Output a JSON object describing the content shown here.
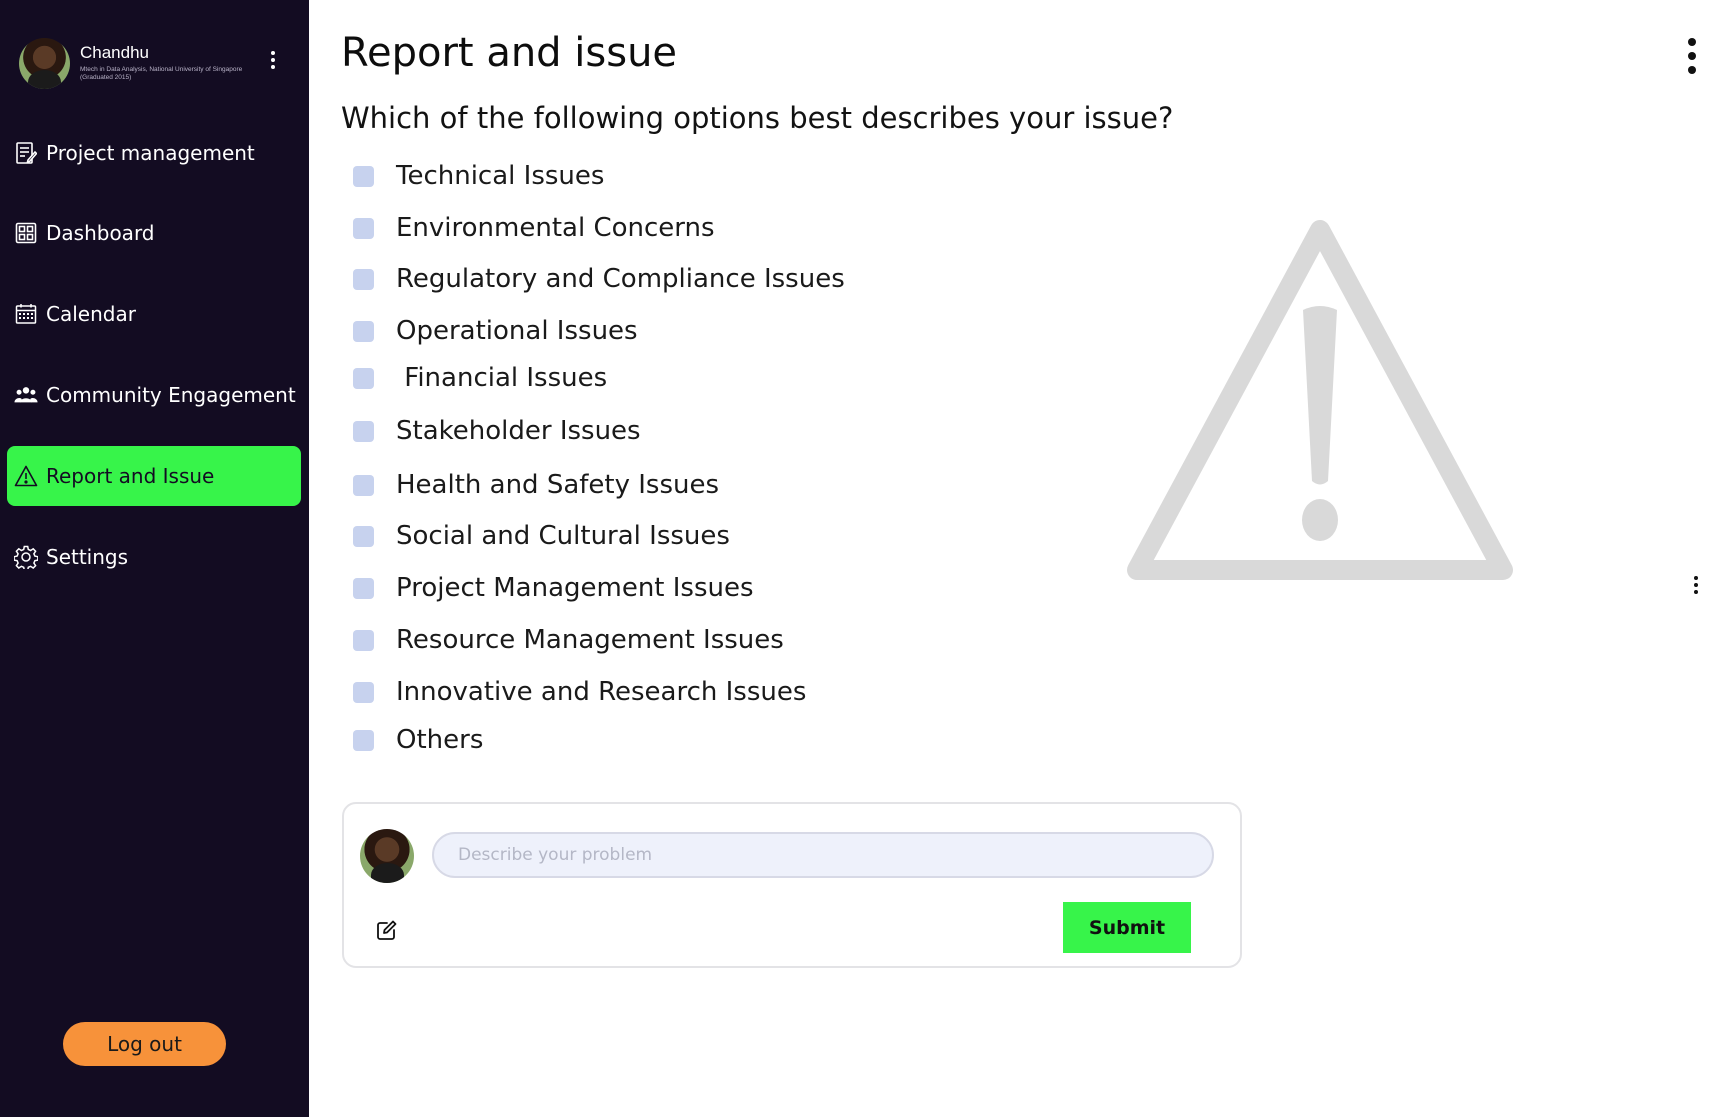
{
  "profile": {
    "name": "Chandhu",
    "subtitle": "Mtech in Data Analysis, National University of Singapore (Graduated 2015)"
  },
  "sidebar": {
    "items": [
      {
        "label": "Project management",
        "icon": "document-edit-icon",
        "active": false
      },
      {
        "label": "Dashboard",
        "icon": "grid-icon",
        "active": false
      },
      {
        "label": "Calendar",
        "icon": "calendar-icon",
        "active": false
      },
      {
        "label": "Community Engagement",
        "icon": "people-icon",
        "active": false
      },
      {
        "label": "Report and Issue",
        "icon": "warning-icon",
        "active": true
      },
      {
        "label": "Settings",
        "icon": "gear-icon",
        "active": false
      }
    ],
    "logout_label": "Log out"
  },
  "main": {
    "title": "Report and issue",
    "question": "Which of the following options best describes your issue?",
    "options": [
      "Technical Issues",
      "Environmental Concerns",
      "Regulatory and Compliance Issues",
      "Operational Issues",
      " Financial Issues",
      "Stakeholder Issues",
      "Health and Safety Issues",
      "Social and Cultural Issues",
      "Project Management Issues",
      "Resource Management Issues",
      "Innovative and Research Issues",
      "Others"
    ]
  },
  "compose": {
    "placeholder": "Describe your problem",
    "submit_label": "Submit"
  },
  "colors": {
    "sidebar_bg": "#130c22",
    "accent_green": "#37f44a",
    "logout_orange": "#f7923a",
    "checkbox": "#c7d2ee",
    "warning_gray": "#d9d9d9"
  }
}
